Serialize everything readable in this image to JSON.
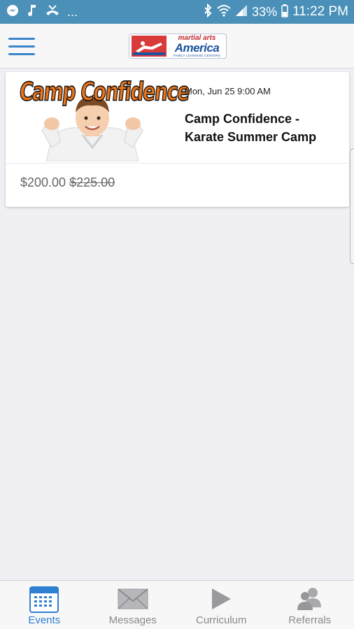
{
  "status_bar": {
    "left_overflow": "...",
    "battery": "33%",
    "time": "11:22 PM",
    "icons": [
      "messenger-icon",
      "music-note-icon",
      "missed-call-icon",
      "bluetooth-icon",
      "wifi-icon",
      "signal-icon",
      "battery-icon"
    ]
  },
  "header": {
    "menu_icon": "hamburger-menu-icon",
    "logo": {
      "line1": "martial arts",
      "line2": "America",
      "line3": "FAMILY LEARNING CENTERS"
    }
  },
  "events": [
    {
      "image_text": "Camp Confidence",
      "date": "Mon, Jun 25 9:00 AM",
      "title": "Camp Confidence - Karate Summer Camp",
      "price": "$200.00",
      "original_price": "$225.00"
    }
  ],
  "tabs": [
    {
      "label": "Events",
      "icon": "calendar-icon",
      "active": true
    },
    {
      "label": "Messages",
      "icon": "envelope-icon",
      "active": false
    },
    {
      "label": "Curriculum",
      "icon": "play-icon",
      "active": false
    },
    {
      "label": "Referrals",
      "icon": "people-icon",
      "active": false
    }
  ],
  "colors": {
    "status_bar": "#4a90b8",
    "accent": "#2f7fd0",
    "inactive_tab": "#8a8a8e",
    "background": "#efeff4",
    "banner_orange": "#e8741c"
  }
}
